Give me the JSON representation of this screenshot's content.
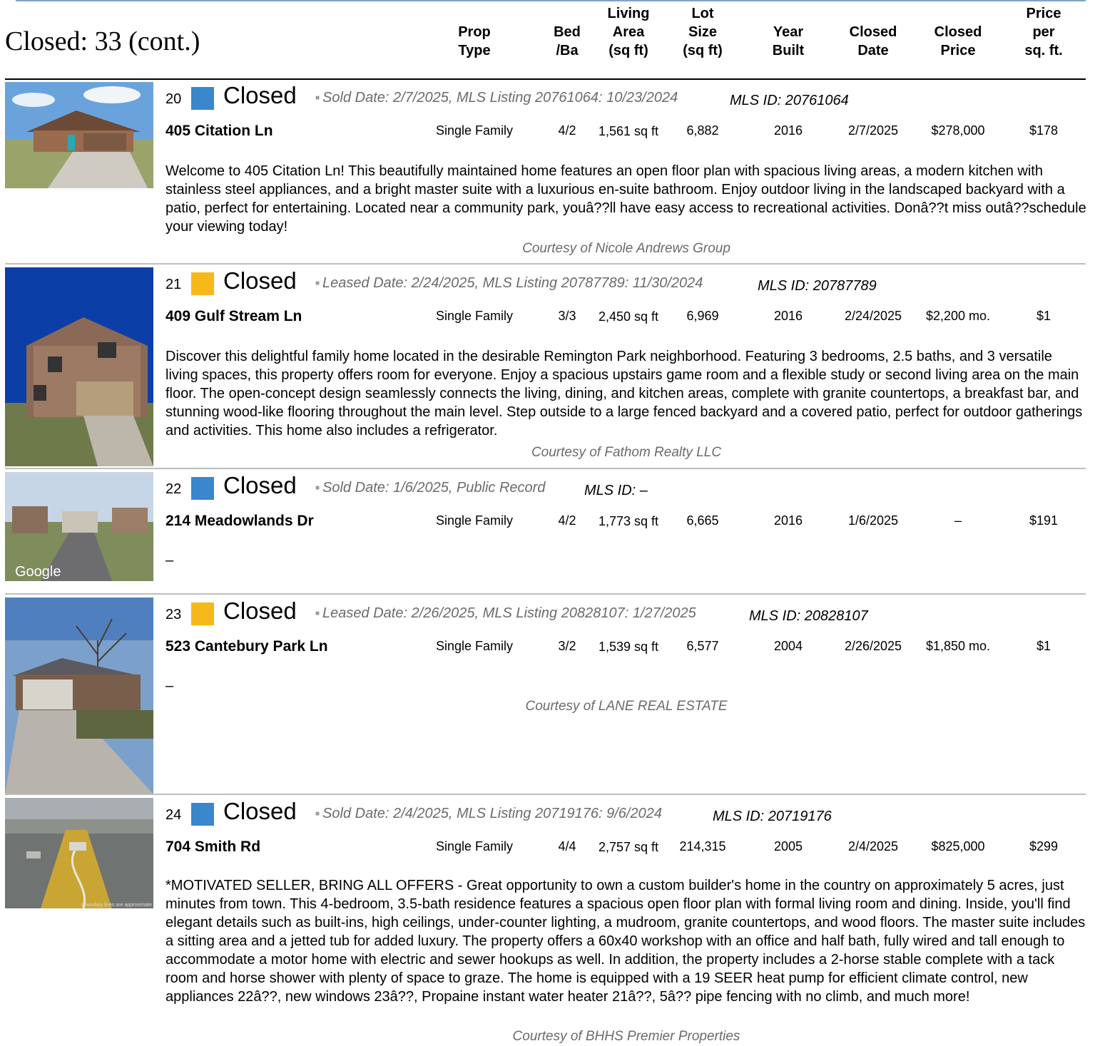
{
  "page_title": "Closed: 33 (cont.)",
  "columns": [
    {
      "label": "Prop\nType"
    },
    {
      "label": "Bed\n/Ba"
    },
    {
      "label": "Living\nArea\n(sq ft)"
    },
    {
      "label": "Lot\nSize\n(sq ft)"
    },
    {
      "label": "Year\nBuilt"
    },
    {
      "label": "Closed\nDate"
    },
    {
      "label": "Closed\nPrice"
    },
    {
      "label": "Price\nper\nsq. ft."
    }
  ],
  "colors": {
    "sold": "#3a87cc",
    "leased": "#f6b91a"
  },
  "listings": [
    {
      "num": "20",
      "status": "Closed",
      "swatch": "sold",
      "sold_info": "Sold Date: 2/7/2025, MLS Listing 20761064: 10/23/2024",
      "mls_id": "MLS ID: 20761064",
      "address": "405 Citation Ln",
      "prop_type": "Single Family",
      "bed_ba": "4/2",
      "living_area": "1,561 sq ft",
      "lot_size": "6,882",
      "year_built": "2016",
      "closed_date": "2/7/2025",
      "closed_price": "$278,000",
      "price_per_sqft": "$178",
      "description": "Welcome to 405 Citation Ln! This beautifully maintained home features an open floor plan with spacious living areas, a modern kitchen with stainless steel appliances, and a bright master suite with a luxurious en-suite bathroom. Enjoy outdoor living in the landscaped backyard with a patio, perfect for entertaining. Located near a community park, youâ??ll have easy access to recreational activities. Donâ??t miss outâ??schedule your viewing today!",
      "courtesy": "Courtesy of Nicole Andrews Group",
      "photo_icon": "house-photo"
    },
    {
      "num": "21",
      "status": "Closed",
      "swatch": "leased",
      "sold_info": "Leased Date: 2/24/2025, MLS Listing 20787789: 11/30/2024",
      "mls_id": "MLS ID: 20787789",
      "address": "409 Gulf Stream Ln",
      "prop_type": "Single Family",
      "bed_ba": "3/3",
      "living_area": "2,450 sq ft",
      "lot_size": "6,969",
      "year_built": "2016",
      "closed_date": "2/24/2025",
      "closed_price": "$2,200 mo.",
      "price_per_sqft": "$1",
      "description": "Discover this delightful family home located in the desirable Remington Park neighborhood. Featuring 3 bedrooms, 2.5 baths, and 3 versatile living spaces, this property offers room for everyone. Enjoy a spacious upstairs game room and a flexible study or second living area on the main floor. The open-concept design seamlessly connects the living, dining, and kitchen areas, complete with granite countertops, a breakfast bar, and stunning wood-like flooring throughout the main level. Step outside to a large fenced backyard and a covered patio, perfect for outdoor gatherings and activities. This home also includes a refrigerator.",
      "courtesy": "Courtesy of Fathom Realty LLC",
      "photo_icon": "house-photo"
    },
    {
      "num": "22",
      "status": "Closed",
      "swatch": "sold",
      "sold_info": "Sold Date: 1/6/2025, Public Record",
      "mls_id": "MLS ID: –",
      "address": "214 Meadowlands Dr",
      "prop_type": "Single Family",
      "bed_ba": "4/2",
      "living_area": "1,773 sq ft",
      "lot_size": "6,665",
      "year_built": "2016",
      "closed_date": "1/6/2025",
      "closed_price": "–",
      "price_per_sqft": "$191",
      "description": "–",
      "courtesy": "",
      "photo_icon": "street-view-photo",
      "photo_watermark": "Google"
    },
    {
      "num": "23",
      "status": "Closed",
      "swatch": "leased",
      "sold_info": "Leased Date: 2/26/2025, MLS Listing 20828107: 1/27/2025",
      "mls_id": "MLS ID: 20828107",
      "address": "523 Cantebury Park Ln",
      "prop_type": "Single Family",
      "bed_ba": "3/2",
      "living_area": "1,539 sq ft",
      "lot_size": "6,577",
      "year_built": "2004",
      "closed_date": "2/26/2025",
      "closed_price": "$1,850 mo.",
      "price_per_sqft": "$1",
      "description": "–",
      "courtesy": "Courtesy of LANE REAL ESTATE",
      "photo_icon": "house-photo"
    },
    {
      "num": "24",
      "status": "Closed",
      "swatch": "sold",
      "sold_info": "Sold Date: 2/4/2025, MLS Listing 20719176: 9/6/2024",
      "mls_id": "MLS ID: 20719176",
      "address": "704 Smith Rd",
      "prop_type": "Single Family",
      "bed_ba": "4/4",
      "living_area": "2,757 sq ft",
      "lot_size": "214,315",
      "year_built": "2005",
      "closed_date": "2/4/2025",
      "closed_price": "$825,000",
      "price_per_sqft": "$299",
      "description": "*MOTIVATED SELLER, BRING ALL OFFERS - Great opportunity to own a custom builder's home in the country on approximately 5 acres, just minutes from town. This 4-bedroom, 3.5-bath residence features a spacious open floor plan with formal living room and dining. Inside, you'll find elegant details such as built-ins, high ceilings, under-counter lighting, a mudroom, granite countertops, and wood floors. The master suite includes a sitting area and a jetted tub for added luxury. The property offers a 60x40 workshop with an office and half bath, fully wired and tall enough to accommodate a motor home with electric and sewer hookups as well. In addition, the property includes a 2-horse stable complete with a tack room and horse shower with plenty of space to graze. The home is equipped with a 19 SEER heat pump for efficient climate control, new appliances 22â??, new windows 23â??, Propaine instant water heater 21â??, 5â?? pipe fencing with no climb, and much more!",
      "courtesy": "Courtesy of BHHS Premier Properties",
      "photo_icon": "aerial-photo",
      "photo_watermark": "Boundary lines are approximate"
    }
  ]
}
